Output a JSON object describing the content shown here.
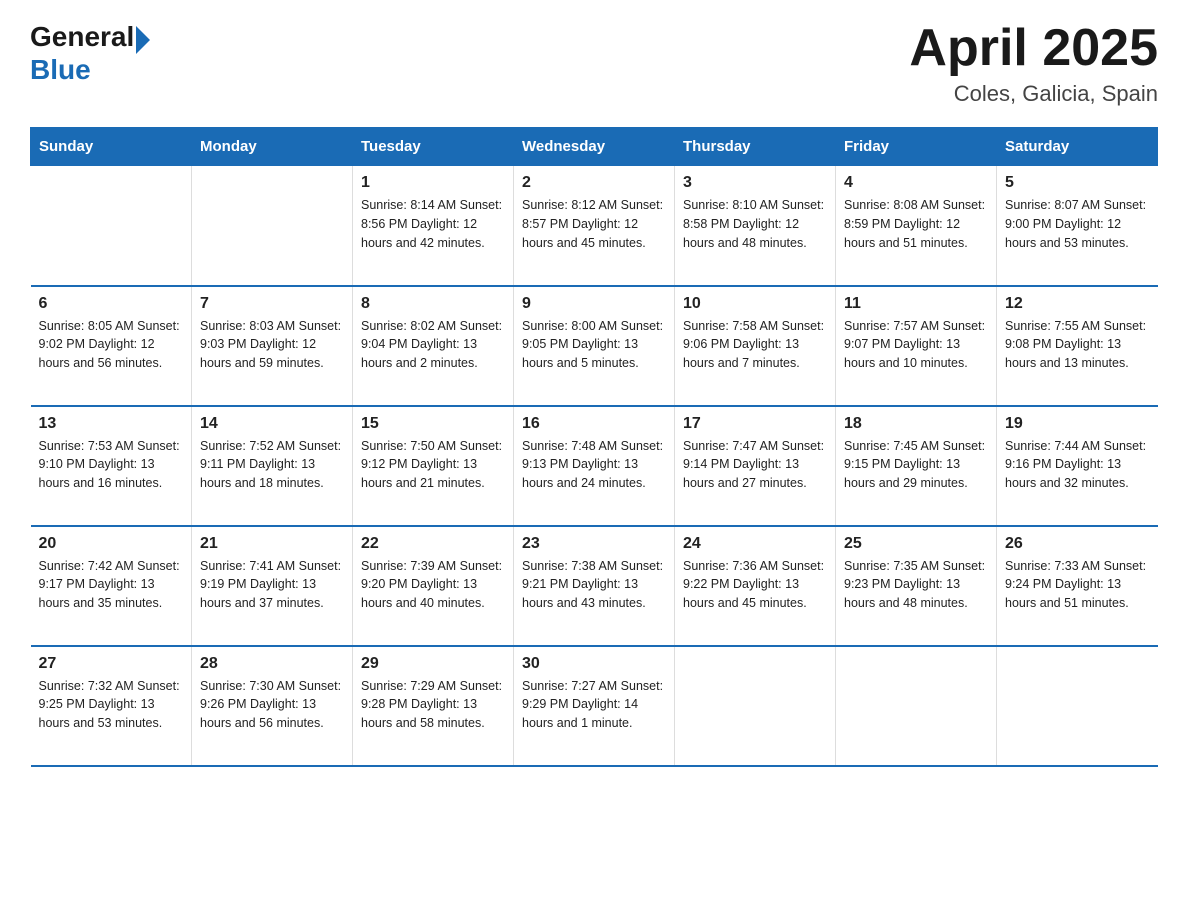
{
  "logo": {
    "general": "General",
    "blue": "Blue"
  },
  "title": "April 2025",
  "subtitle": "Coles, Galicia, Spain",
  "headers": [
    "Sunday",
    "Monday",
    "Tuesday",
    "Wednesday",
    "Thursday",
    "Friday",
    "Saturday"
  ],
  "weeks": [
    [
      {
        "day": "",
        "info": ""
      },
      {
        "day": "",
        "info": ""
      },
      {
        "day": "1",
        "info": "Sunrise: 8:14 AM\nSunset: 8:56 PM\nDaylight: 12 hours\nand 42 minutes."
      },
      {
        "day": "2",
        "info": "Sunrise: 8:12 AM\nSunset: 8:57 PM\nDaylight: 12 hours\nand 45 minutes."
      },
      {
        "day": "3",
        "info": "Sunrise: 8:10 AM\nSunset: 8:58 PM\nDaylight: 12 hours\nand 48 minutes."
      },
      {
        "day": "4",
        "info": "Sunrise: 8:08 AM\nSunset: 8:59 PM\nDaylight: 12 hours\nand 51 minutes."
      },
      {
        "day": "5",
        "info": "Sunrise: 8:07 AM\nSunset: 9:00 PM\nDaylight: 12 hours\nand 53 minutes."
      }
    ],
    [
      {
        "day": "6",
        "info": "Sunrise: 8:05 AM\nSunset: 9:02 PM\nDaylight: 12 hours\nand 56 minutes."
      },
      {
        "day": "7",
        "info": "Sunrise: 8:03 AM\nSunset: 9:03 PM\nDaylight: 12 hours\nand 59 minutes."
      },
      {
        "day": "8",
        "info": "Sunrise: 8:02 AM\nSunset: 9:04 PM\nDaylight: 13 hours\nand 2 minutes."
      },
      {
        "day": "9",
        "info": "Sunrise: 8:00 AM\nSunset: 9:05 PM\nDaylight: 13 hours\nand 5 minutes."
      },
      {
        "day": "10",
        "info": "Sunrise: 7:58 AM\nSunset: 9:06 PM\nDaylight: 13 hours\nand 7 minutes."
      },
      {
        "day": "11",
        "info": "Sunrise: 7:57 AM\nSunset: 9:07 PM\nDaylight: 13 hours\nand 10 minutes."
      },
      {
        "day": "12",
        "info": "Sunrise: 7:55 AM\nSunset: 9:08 PM\nDaylight: 13 hours\nand 13 minutes."
      }
    ],
    [
      {
        "day": "13",
        "info": "Sunrise: 7:53 AM\nSunset: 9:10 PM\nDaylight: 13 hours\nand 16 minutes."
      },
      {
        "day": "14",
        "info": "Sunrise: 7:52 AM\nSunset: 9:11 PM\nDaylight: 13 hours\nand 18 minutes."
      },
      {
        "day": "15",
        "info": "Sunrise: 7:50 AM\nSunset: 9:12 PM\nDaylight: 13 hours\nand 21 minutes."
      },
      {
        "day": "16",
        "info": "Sunrise: 7:48 AM\nSunset: 9:13 PM\nDaylight: 13 hours\nand 24 minutes."
      },
      {
        "day": "17",
        "info": "Sunrise: 7:47 AM\nSunset: 9:14 PM\nDaylight: 13 hours\nand 27 minutes."
      },
      {
        "day": "18",
        "info": "Sunrise: 7:45 AM\nSunset: 9:15 PM\nDaylight: 13 hours\nand 29 minutes."
      },
      {
        "day": "19",
        "info": "Sunrise: 7:44 AM\nSunset: 9:16 PM\nDaylight: 13 hours\nand 32 minutes."
      }
    ],
    [
      {
        "day": "20",
        "info": "Sunrise: 7:42 AM\nSunset: 9:17 PM\nDaylight: 13 hours\nand 35 minutes."
      },
      {
        "day": "21",
        "info": "Sunrise: 7:41 AM\nSunset: 9:19 PM\nDaylight: 13 hours\nand 37 minutes."
      },
      {
        "day": "22",
        "info": "Sunrise: 7:39 AM\nSunset: 9:20 PM\nDaylight: 13 hours\nand 40 minutes."
      },
      {
        "day": "23",
        "info": "Sunrise: 7:38 AM\nSunset: 9:21 PM\nDaylight: 13 hours\nand 43 minutes."
      },
      {
        "day": "24",
        "info": "Sunrise: 7:36 AM\nSunset: 9:22 PM\nDaylight: 13 hours\nand 45 minutes."
      },
      {
        "day": "25",
        "info": "Sunrise: 7:35 AM\nSunset: 9:23 PM\nDaylight: 13 hours\nand 48 minutes."
      },
      {
        "day": "26",
        "info": "Sunrise: 7:33 AM\nSunset: 9:24 PM\nDaylight: 13 hours\nand 51 minutes."
      }
    ],
    [
      {
        "day": "27",
        "info": "Sunrise: 7:32 AM\nSunset: 9:25 PM\nDaylight: 13 hours\nand 53 minutes."
      },
      {
        "day": "28",
        "info": "Sunrise: 7:30 AM\nSunset: 9:26 PM\nDaylight: 13 hours\nand 56 minutes."
      },
      {
        "day": "29",
        "info": "Sunrise: 7:29 AM\nSunset: 9:28 PM\nDaylight: 13 hours\nand 58 minutes."
      },
      {
        "day": "30",
        "info": "Sunrise: 7:27 AM\nSunset: 9:29 PM\nDaylight: 14 hours\nand 1 minute."
      },
      {
        "day": "",
        "info": ""
      },
      {
        "day": "",
        "info": ""
      },
      {
        "day": "",
        "info": ""
      }
    ]
  ]
}
